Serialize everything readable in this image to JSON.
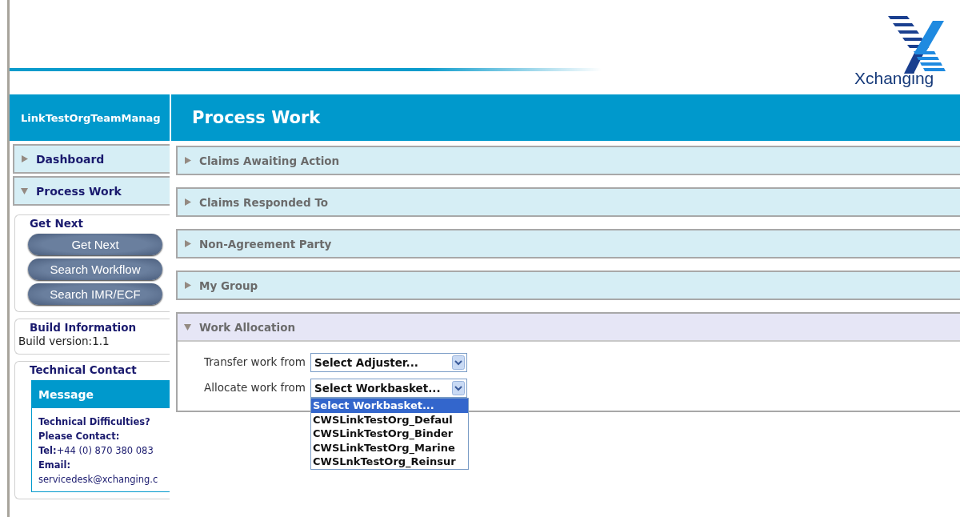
{
  "header": {
    "logo": "Xchanging"
  },
  "sidebar": {
    "user": "LinkTestOrgTeamManag",
    "nav": [
      {
        "label": "Dashboard",
        "expanded": false
      },
      {
        "label": "Process Work",
        "expanded": true
      }
    ],
    "get_next": {
      "title": "Get Next",
      "buttons": [
        "Get Next",
        "Search Workflow",
        "Search IMR/ECF"
      ]
    },
    "build": {
      "title": "Build Information",
      "text": "Build version:1.1"
    },
    "contact": {
      "title": "Technical Contact",
      "message_title": "Message",
      "lines": [
        "**Technical Difficulties?**",
        "**Please Contact:**",
        "**Tel:**+44 (0) 870 380 083",
        "**Email:**",
        "servicedesk@xchanging.c"
      ]
    }
  },
  "main": {
    "title": "Process Work",
    "sections": [
      {
        "label": "Claims Awaiting Action",
        "expanded": false
      },
      {
        "label": "Claims Responded To",
        "expanded": false
      },
      {
        "label": "Non-Agreement Party",
        "expanded": false
      },
      {
        "label": "My Group",
        "expanded": false
      },
      {
        "label": "Work Allocation",
        "expanded": true
      }
    ],
    "form": [
      {
        "label": "Transfer work from",
        "value": "Select Adjuster..."
      },
      {
        "label": "Allocate work from",
        "value": "Select Workbasket...",
        "options": [
          {
            "label": "Select Workbasket...",
            "selected": true
          },
          {
            "label": "CWSLinkTestOrg_Defaul",
            "selected": false
          },
          {
            "label": "CWSLinkTestOrg_Binder",
            "selected": false
          },
          {
            "label": "CWSLinkTestOrg_Marine",
            "selected": false
          },
          {
            "label": "CWSLnkTestOrg_Reinsur",
            "selected": false
          }
        ]
      }
    ]
  }
}
